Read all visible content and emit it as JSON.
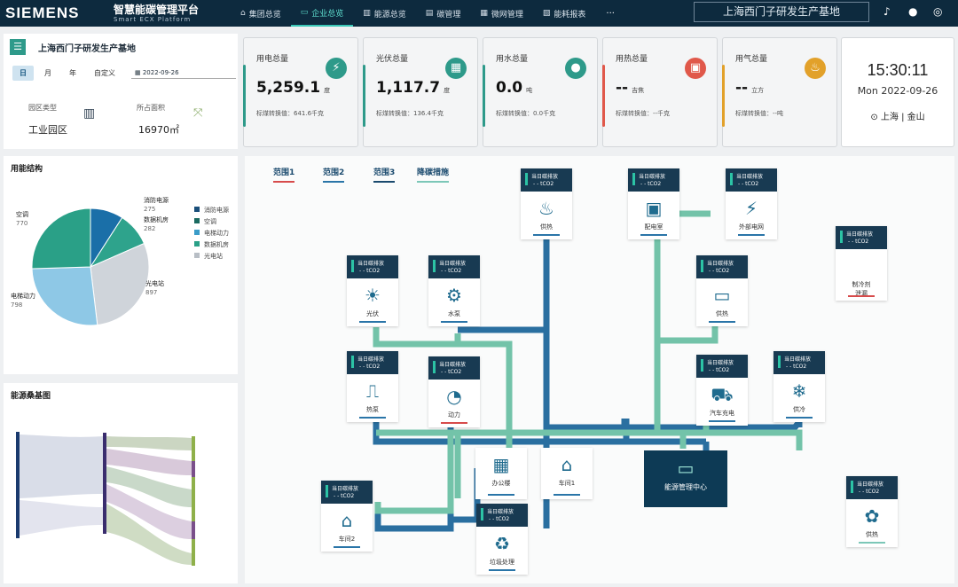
{
  "brand": "SIEMENS",
  "platform": {
    "title_zh": "智慧能碳管理平台",
    "title_en": "Smart ECX Platform"
  },
  "nav": [
    {
      "label": "集团总览",
      "icon": "⌂"
    },
    {
      "label": "企业总览",
      "icon": "▭",
      "active": true
    },
    {
      "label": "能源总览",
      "icon": "▥"
    },
    {
      "label": "碳管理",
      "icon": "▤"
    },
    {
      "label": "微网管理",
      "icon": "▦"
    },
    {
      "label": "能耗报表",
      "icon": "▧"
    }
  ],
  "nav_more": "···",
  "site_selector": "上海西门子研发生产基地",
  "site": {
    "name": "上海西门子研发生产基地",
    "tabs": [
      "日",
      "月",
      "年",
      "自定义"
    ],
    "date": "2022-09-26",
    "park_type_label": "园区类型",
    "park_type": "工业园区",
    "area_label": "所占面积",
    "area": "16970㎡"
  },
  "stats": [
    {
      "label": "用电总量",
      "value": "5,259.1",
      "unit": "度",
      "sub": "标煤转换值：641.6千克",
      "color": "#2e9a8a",
      "icon": "⚡"
    },
    {
      "label": "光伏总量",
      "value": "1,117.7",
      "unit": "度",
      "sub": "标煤转换值：136.4千克",
      "color": "#2e9a8a",
      "icon": "▦"
    },
    {
      "label": "用水总量",
      "value": "0.0",
      "unit": "吨",
      "sub": "标煤转换值：0.0千克",
      "color": "#2e9a8a",
      "icon": "●"
    },
    {
      "label": "用热总量",
      "value": "--",
      "unit": "吉焦",
      "sub": "标煤转换值：--千克",
      "color": "#e0584a",
      "icon": "▣"
    },
    {
      "label": "用气总量",
      "value": "--",
      "unit": "立方",
      "sub": "标煤转换值：--吨",
      "color": "#e2a12a",
      "icon": "♨"
    }
  ],
  "clock": {
    "time": "15:30:11",
    "date": "Mon  2022-09-26",
    "location": "上海 | 金山"
  },
  "structure": {
    "title": "用能结构",
    "slice_labels": [
      {
        "name": "消防电源",
        "value": "275"
      },
      {
        "name": "数据机房",
        "value": "282"
      },
      {
        "name": "光电站",
        "value": "897"
      },
      {
        "name": "电梯动力",
        "value": "798"
      },
      {
        "name": "空调",
        "value": "770"
      }
    ],
    "legend": [
      "消防电源",
      "空调",
      "电梯动力",
      "数据机房",
      "光电站"
    ]
  },
  "chart_data": {
    "type": "pie",
    "title": "用能结构",
    "categories": [
      "消防电源",
      "数据机房",
      "光电站",
      "电梯动力",
      "空调"
    ],
    "values": [
      275,
      282,
      897,
      798,
      770
    ],
    "colors": [
      "#1a6fa8",
      "#2ea38c",
      "#cfd4da",
      "#8ec8e6",
      "#2aa087"
    ],
    "legend_position": "right"
  },
  "sankey": {
    "title": "能源桑基图"
  },
  "scopes": [
    {
      "label": "范围1",
      "color": "#d74b4b"
    },
    {
      "label": "范围2",
      "color": "#2a75a8"
    },
    {
      "label": "范围3",
      "color": "#1a4a6e"
    },
    {
      "label": "降碳措施",
      "color": "#7cc7b8"
    }
  ],
  "node_header": {
    "line1": "当日碳排放",
    "line2": "- - tCO2"
  },
  "nodes": [
    {
      "id": "heat-top",
      "label": "供热",
      "glyph": "♨"
    },
    {
      "id": "substation",
      "label": "配电室",
      "glyph": "▣"
    },
    {
      "id": "grid",
      "label": "外部电网",
      "glyph": "⚡"
    },
    {
      "id": "refrigerant",
      "label": "制冷剂\n泄漏",
      "glyph": ""
    },
    {
      "id": "pv",
      "label": "光伏",
      "glyph": "☀"
    },
    {
      "id": "pump",
      "label": "水泵",
      "glyph": "⚙"
    },
    {
      "id": "heat-right",
      "label": "供热",
      "glyph": "▭"
    },
    {
      "id": "heatpump",
      "label": "热泵",
      "glyph": "⎍"
    },
    {
      "id": "power",
      "label": "动力",
      "glyph": "◔"
    },
    {
      "id": "ev",
      "label": "汽车充电",
      "glyph": "⛟"
    },
    {
      "id": "cooling",
      "label": "供冷",
      "glyph": "❄"
    },
    {
      "id": "office",
      "label": "办公楼",
      "glyph": "▦"
    },
    {
      "id": "workshop1",
      "label": "车间1",
      "glyph": "⌂"
    },
    {
      "id": "workshop2",
      "label": "车间2",
      "glyph": "⌂"
    },
    {
      "id": "waste",
      "label": "垃圾处理",
      "glyph": "♻"
    },
    {
      "id": "heat-green",
      "label": "供热",
      "glyph": "✿"
    }
  ],
  "center": {
    "label": "能源管理中心",
    "glyph": "▭"
  }
}
